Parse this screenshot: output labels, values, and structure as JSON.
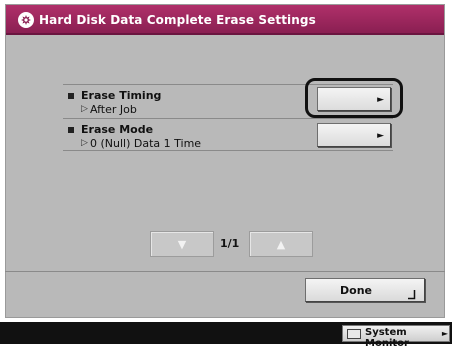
{
  "window": {
    "title": "Hard Disk Data Complete Erase Settings",
    "title_icon": "gear-icon",
    "title_bar_color": "#9b2760"
  },
  "settings": [
    {
      "name": "Erase Timing",
      "value": "After Job",
      "selected": true
    },
    {
      "name": "Erase Mode",
      "value": "0 (Null) Data 1 Time",
      "selected": false
    }
  ],
  "pager": {
    "up_icon": "arrow-up-icon",
    "down_icon": "arrow-down-icon",
    "page_indicator": "1/1"
  },
  "done_button": {
    "label": "Done",
    "icon": "enter-icon"
  },
  "status_bar": {
    "system_monitor_label": "System Monitor"
  }
}
